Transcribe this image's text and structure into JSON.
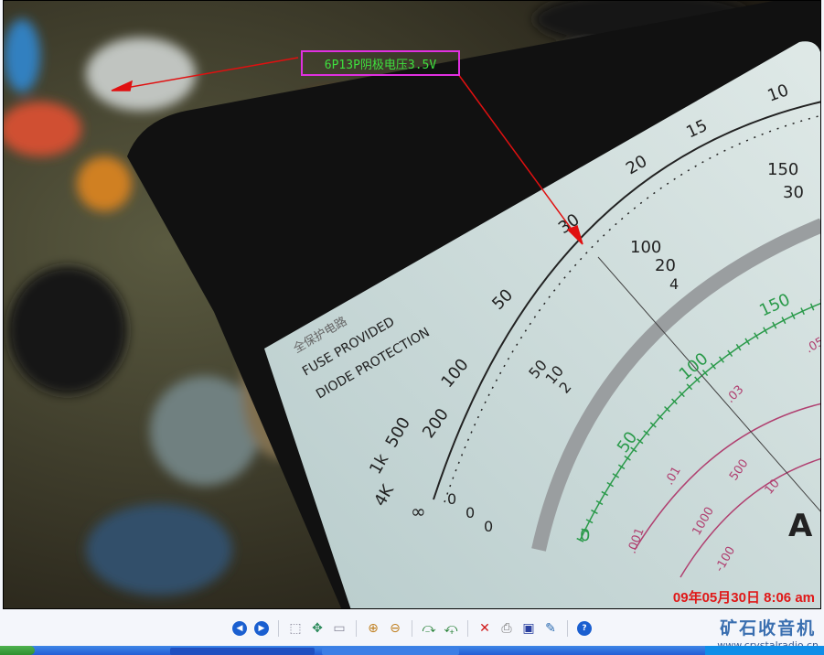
{
  "photo": {
    "annotation": "6P13P阴极电压3.5V",
    "timestamp": "09年05月30日 8:06 am",
    "meter_text": {
      "fuse": "FUSE PROVIDED",
      "diode": "DIODE PROTECTION",
      "protect": "全保护电路",
      "ohm_scale": [
        "∞",
        "4K",
        "1k",
        "500",
        "200",
        "100",
        "50",
        "30",
        "20",
        "15",
        "10"
      ],
      "dcv_a": [
        "0",
        "2",
        "4"
      ],
      "dcv_b": [
        "0",
        "10",
        "20",
        "30"
      ],
      "dcv_c": [
        "0",
        "50",
        "100",
        "150"
      ],
      "ac_scale": [
        "0",
        "50",
        "100",
        "150"
      ],
      "hfe": [
        ".001",
        ".01",
        ".03",
        ".05"
      ],
      "pink": [
        "1000",
        "500",
        "10",
        "-100"
      ],
      "brand": "A"
    }
  },
  "toolbar": {
    "buttons": [
      {
        "name": "previous-image-button",
        "icon": "prev-icon",
        "glyph": "◀"
      },
      {
        "name": "next-image-button",
        "icon": "next-icon",
        "glyph": "▶"
      },
      {
        "name": "best-fit-button",
        "icon": "best-fit-icon",
        "glyph": "⬚"
      },
      {
        "name": "actual-size-button",
        "icon": "actual-size-icon",
        "glyph": "✥"
      },
      {
        "name": "slideshow-button",
        "icon": "slideshow-icon",
        "glyph": "▭"
      },
      {
        "name": "zoom-in-button",
        "icon": "zoom-in-icon",
        "glyph": "⊕"
      },
      {
        "name": "zoom-out-button",
        "icon": "zoom-out-icon",
        "glyph": "⊖"
      },
      {
        "name": "rotate-clockwise-button",
        "icon": "rotate-cw-icon",
        "glyph": "⤼"
      },
      {
        "name": "rotate-counterclockwise-button",
        "icon": "rotate-ccw-icon",
        "glyph": "⤽"
      },
      {
        "name": "delete-button",
        "icon": "delete-icon",
        "glyph": "✕"
      },
      {
        "name": "print-button",
        "icon": "print-icon",
        "glyph": "⎙"
      },
      {
        "name": "save-button",
        "icon": "save-icon",
        "glyph": "▣"
      },
      {
        "name": "edit-button",
        "icon": "edit-icon",
        "glyph": "✎"
      },
      {
        "name": "help-button",
        "icon": "help-icon",
        "glyph": "?"
      }
    ]
  },
  "watermark": {
    "title": "矿石收音机",
    "url": "www.crystalradio.cn"
  },
  "colors": {
    "annotation_border": "#e030e0",
    "annotation_text": "#3ee03e",
    "timestamp": "#e01818",
    "arrow": "#e01010"
  }
}
